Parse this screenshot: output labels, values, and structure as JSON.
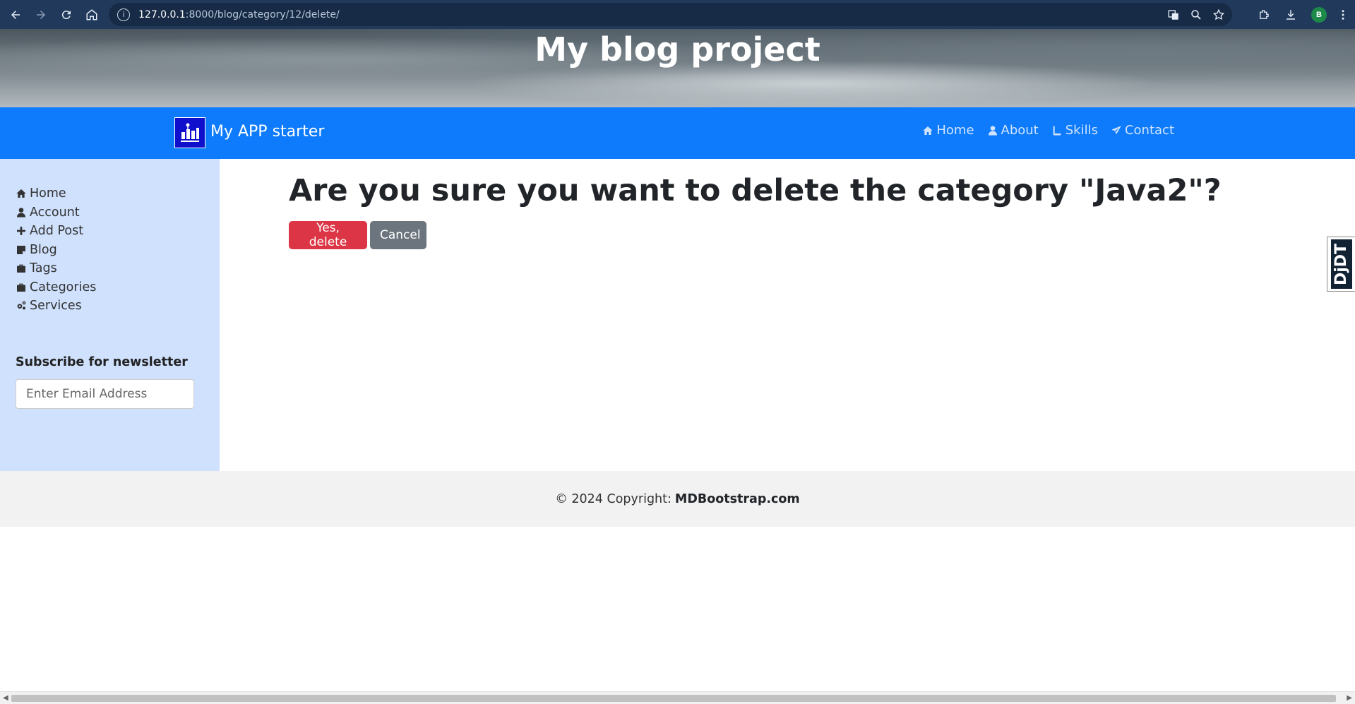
{
  "browser": {
    "url_host": "127.0.0.1",
    "url_path": ":8000/blog/category/12/delete/",
    "profile_initial": "B"
  },
  "hero": {
    "title": "My blog project"
  },
  "navbar": {
    "brand": "My APP starter",
    "links": [
      {
        "label": "Home",
        "icon": "home-icon"
      },
      {
        "label": "About",
        "icon": "user-icon"
      },
      {
        "label": "Skills",
        "icon": "book-icon"
      },
      {
        "label": "Contact",
        "icon": "paper-plane-icon"
      }
    ]
  },
  "sidebar": {
    "items": [
      {
        "label": "Home",
        "icon": "home-icon"
      },
      {
        "label": "Account",
        "icon": "user-icon"
      },
      {
        "label": "Add Post",
        "icon": "plus-icon"
      },
      {
        "label": "Blog",
        "icon": "note-icon"
      },
      {
        "label": "Tags",
        "icon": "briefcase-icon"
      },
      {
        "label": "Categories",
        "icon": "briefcase-icon"
      },
      {
        "label": "Services",
        "icon": "gears-icon"
      }
    ],
    "newsletter_title": "Subscribe for newsletter",
    "newsletter_placeholder": "Enter Email Address"
  },
  "main": {
    "confirm_text": "Are you sure you want to delete the category \"Java2\"?",
    "delete_label": "Yes, delete",
    "cancel_label": "Cancel"
  },
  "djdt": {
    "label": "DjDT"
  },
  "footer": {
    "copyright": "© 2024 Copyright:",
    "link": "MDBootstrap.com"
  }
}
